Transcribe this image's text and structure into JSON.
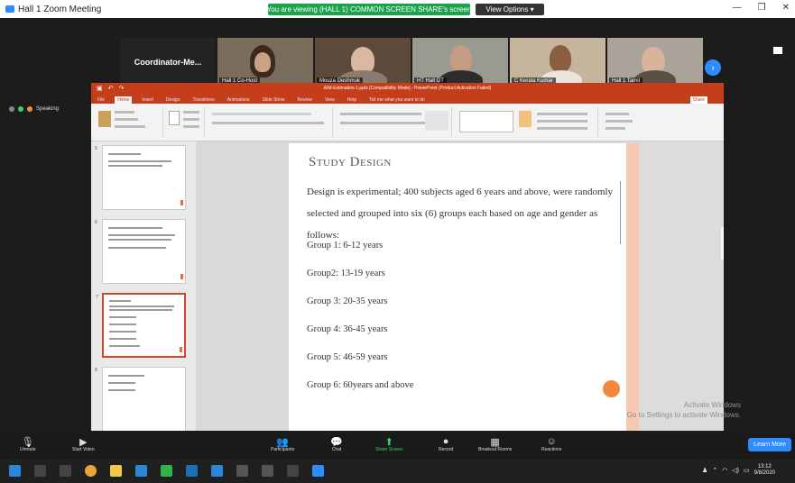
{
  "window": {
    "title": "Hall 1 Zoom Meeting",
    "controls": [
      "—",
      "❐",
      "✕"
    ]
  },
  "share_banner": {
    "text": "You are viewing (HALL 1) COMMON SCREEN SHARE's screen"
  },
  "view_options": {
    "label": "View Options ▾"
  },
  "gallery": {
    "tiles": [
      {
        "label": "Coordinator-Me..."
      },
      {
        "label": "Hall 1 Co-Host"
      },
      {
        "label": "Mouza Deshmuk"
      },
      {
        "label": "HT Hall OT"
      },
      {
        "label": "C Kerala Kumar"
      },
      {
        "label": "Hall 1 Tamil"
      }
    ]
  },
  "shared_status": "Speaking",
  "powerpoint": {
    "title": "AIM-Estimation-1.pptx [Compatibility Mode] - PowerPoint (Product Activation Failed)",
    "tabs": [
      "File",
      "Home",
      "Insert",
      "Design",
      "Transitions",
      "Animations",
      "Slide Show",
      "Review",
      "View",
      "Help",
      "Tell me what you want to do"
    ],
    "active_tab": "Home",
    "share": "Share",
    "slide": {
      "title": "Study Design",
      "body": "Design is experimental; 400 subjects aged 6 years and above, were randomly selected and grouped into six (6) groups each based on age and gender as follows:",
      "groups": [
        "Group 1: 6-12 years",
        "Group2: 13-19 years",
        "Group 3: 20-35 years",
        "Group 4: 36-45 years",
        "Group 5: 46-59 years",
        "Group 6: 60years and above"
      ]
    },
    "thumbnails": [
      "5",
      "6",
      "7",
      "8"
    ]
  },
  "watermark": {
    "line1": "Activate Windows",
    "line2": "Go to Settings to activate Windows."
  },
  "learn_more": "Learn More",
  "toolbar": {
    "items": [
      {
        "label": "Unmute",
        "icon": "mic-icon"
      },
      {
        "label": "Start Video",
        "icon": "video-icon"
      },
      {
        "label": "Participants",
        "icon": "participants-icon"
      },
      {
        "label": "Chat",
        "icon": "chat-icon"
      },
      {
        "label": "Share Screen",
        "icon": "share-screen-icon"
      },
      {
        "label": "Record",
        "icon": "record-icon"
      },
      {
        "label": "Breakout Rooms",
        "icon": "breakout-icon"
      },
      {
        "label": "Reactions",
        "icon": "reactions-icon"
      }
    ]
  },
  "taskbar": {
    "time": "13:12",
    "date": "9/8/2020"
  }
}
